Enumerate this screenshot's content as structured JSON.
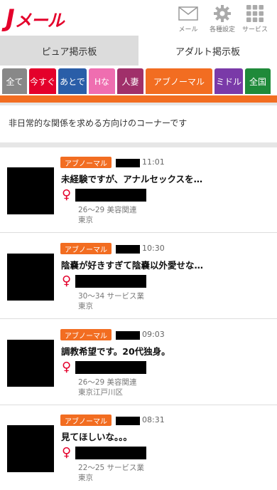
{
  "header": {
    "logo_j": "J",
    "logo_rest": "メール",
    "icons": [
      {
        "name": "mail-icon",
        "label": "メール"
      },
      {
        "name": "gear-icon",
        "label": "各種設定"
      },
      {
        "name": "grid-icon",
        "label": "サービス"
      }
    ]
  },
  "board_tabs": {
    "pure": "ピュア掲示板",
    "adult": "アダルト掲示板"
  },
  "categories": [
    {
      "label": "全て",
      "color": "#888888"
    },
    {
      "label": "今すぐ",
      "color": "#e4002b"
    },
    {
      "label": "あとで",
      "color": "#2a5ea8"
    },
    {
      "label": "Hな",
      "color": "#ef6eb0"
    },
    {
      "label": "人妻",
      "color": "#a0306a"
    },
    {
      "label": "アブノーマル",
      "color": "#f26d21"
    },
    {
      "label": "ミドル",
      "color": "#7a3aa8"
    },
    {
      "label": "全国",
      "color": "#1f8a3a"
    }
  ],
  "description": "非日常的な関係を求める方向けのコーナーです",
  "posts": [
    {
      "badge": "アブノーマル",
      "time": "11:01",
      "title": "未経験ですが、アナルセックスを…",
      "gender": "♀",
      "age_job": "26～29 美容関連",
      "location": "東京"
    },
    {
      "badge": "アブノーマル",
      "time": "10:30",
      "title": "陰嚢が好きすぎて陰嚢以外愛せな…",
      "gender": "♀",
      "age_job": "30～34 サービス業",
      "location": "東京"
    },
    {
      "badge": "アブノーマル",
      "time": "09:03",
      "title": "調教希望です。20代独身。",
      "gender": "♀",
      "age_job": "26～29 美容関連",
      "location": "東京江戸川区"
    },
    {
      "badge": "アブノーマル",
      "time": "08:31",
      "title": "見てほしいな。。。",
      "gender": "♀",
      "age_job": "22～25 サービス業",
      "location": "東京"
    }
  ]
}
